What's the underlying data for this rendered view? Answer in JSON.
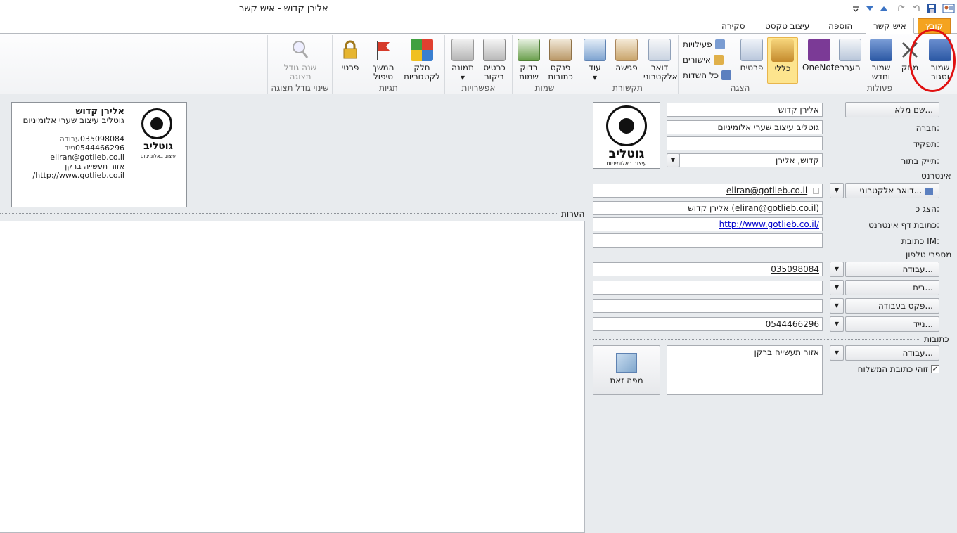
{
  "window": {
    "title": "אלירן קדוש  -  איש קשר"
  },
  "tabs": {
    "file": "קובץ",
    "contact": "איש קשר",
    "insert": "הוספה",
    "format_text": "עיצוב טקסט",
    "review": "סקירה"
  },
  "ribbon": {
    "actions": {
      "label": "פעולות",
      "save_close": "שמור וסגור",
      "delete": "מחק",
      "save_new": "שמור וחדש",
      "forward": "העבר",
      "onenote": "OneNote"
    },
    "show": {
      "label": "הצגה",
      "general": "כללי",
      "details": "פרטים",
      "activities": "פעילויות",
      "certificates": "אישורים",
      "all_fields": "כל השדות"
    },
    "communicate": {
      "label": "תקשורת",
      "email": "דואר אלקטרוני",
      "meeting": "פגישה",
      "more": "עוד"
    },
    "names": {
      "label": "שמות",
      "address_book": "פנקס כתובות",
      "check_names": "בדוק שמות"
    },
    "options": {
      "label": "אפשרויות",
      "business_card": "כרטיס ביקור",
      "picture": "תמונה"
    },
    "tags": {
      "label": "תגיות",
      "categorize": "חלק לקטגוריות",
      "follow_up": "המשך טיפול",
      "private": "פרטי"
    },
    "zoom": {
      "label": "שינוי גודל תצוגה",
      "zoom": "שנה גודל תצוגה"
    }
  },
  "form": {
    "full_name_btn": "שם מלא...",
    "full_name": "אלירן קדוש",
    "company_label": "חברה:",
    "company": "גוטליב עיצוב שערי אלומיניום",
    "job_title_label": "תפקיד:",
    "job_title": "",
    "file_as_label": "תייק בתור:",
    "file_as": "קדוש, אלירן",
    "internet_label": "אינטרנט",
    "email_btn": "דואר אלקטרוני...",
    "email": "eliran@gotlieb.co.il",
    "display_as_label": "הצג כ:",
    "display_as": "אלירן קדוש (eliran@gotlieb.co.il)",
    "web_label": "כתובת דף אינטרנט:",
    "web": "http://www.gotlieb.co.il/",
    "im_label": "כתובת IM:",
    "im": "",
    "phones_label": "מספרי טלפון",
    "work_btn": "עבודה...",
    "work_phone": "035098084",
    "home_btn": "בית...",
    "home_phone": "",
    "fax_btn": "פקס בעבודה...",
    "fax": "",
    "mobile_btn": "נייד...",
    "mobile": "0544466296",
    "addresses_label": "כתובות",
    "address_btn": "עבודה...",
    "address": "אזור תעשייה ברקן",
    "mailing_label": "זוהי כתובת המשלוח",
    "map_btn": "מפה זאת"
  },
  "logo": {
    "name": "גוטליב",
    "sub": "עיצוב באלומיניום"
  },
  "card": {
    "name": "אלירן קדוש",
    "company": "גוטליב עיצוב שערי אלומיניום",
    "work_phone": "035098084",
    "work_label": "עבודה",
    "mobile": "0544466296",
    "mobile_label": "נייד",
    "email": "eliran@gotlieb.co.il",
    "address": "אזור תעשייה ברקן",
    "web": "http://www.gotlieb.co.il/"
  },
  "notes": {
    "label": "הערות"
  },
  "colors": {
    "accent": "#f4a31f",
    "selected": "#fde48e",
    "annotation": "#e01010"
  }
}
